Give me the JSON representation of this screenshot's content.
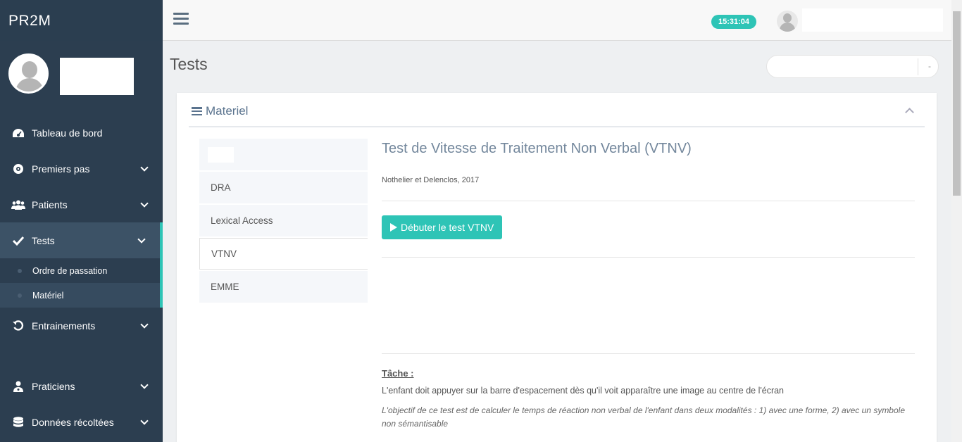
{
  "app": {
    "brand": "PR2M"
  },
  "sidebar": {
    "items": [
      {
        "label": "Tableau de bord",
        "icon": "dashboard-icon"
      },
      {
        "label": "Premiers pas",
        "icon": "compass-icon"
      },
      {
        "label": "Patients",
        "icon": "users-icon"
      },
      {
        "label": "Tests",
        "icon": "check-icon"
      },
      {
        "label": "Entrainements",
        "icon": "refresh-icon"
      },
      {
        "label": "Praticiens",
        "icon": "user-md-icon"
      },
      {
        "label": "Données récoltées",
        "icon": "database-icon"
      }
    ],
    "tests_submenu": [
      {
        "label": "Ordre de passation"
      },
      {
        "label": "Matériel"
      }
    ]
  },
  "topbar": {
    "clock": "15:31:04"
  },
  "page": {
    "title": "Tests",
    "search_toggle": "-"
  },
  "panel": {
    "title": "Materiel",
    "tabs": [
      {
        "label": ""
      },
      {
        "label": "DRA"
      },
      {
        "label": "Lexical Access"
      },
      {
        "label": "VTNV"
      },
      {
        "label": "EMME"
      }
    ],
    "content": {
      "heading": "Test de Vitesse de Traitement Non Verbal (VTNV)",
      "authors": "Nothelier et Delenclos, 2017",
      "start_button": "Débuter le test VTNV",
      "task_label": "Tâche :",
      "task_text": "L'enfant doit appuyer sur la barre d'espacement dès qu'il voit apparaître une image au centre de l'écran",
      "task_objective": "L'objectif de ce test est de calculer le temps de réaction non verbal de l'enfant dans deux modalités : 1) avec une forme, 2) avec un symbole non sémantisable"
    }
  },
  "colors": {
    "sidebar": "#2c3e50",
    "accent": "#2ec4b6",
    "heading": "#73879c"
  }
}
